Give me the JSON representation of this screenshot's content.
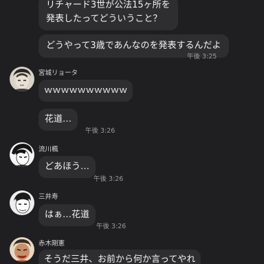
{
  "messages": [
    {
      "sender": "",
      "lines": [
        "リチャード3世が公法15ヶ所を",
        "発表したってどういうこと？"
      ],
      "time": ""
    },
    {
      "sender": "",
      "lines": [
        "どうやって3歳であんなのを発表するんだよ"
      ],
      "time": "午後 3:25"
    },
    {
      "sender": "宮城リョータ",
      "lines": [
        "ｗｗｗｗｗｗｗｗｗｗ"
      ],
      "time": ""
    },
    {
      "sender": "",
      "lines": [
        "花道…"
      ],
      "time": "午後 3:26"
    },
    {
      "sender": "流川楓",
      "lines": [
        "どあほう…"
      ],
      "time": "午後 3:26"
    },
    {
      "sender": "三井寿",
      "lines": [
        "はぁ…花道"
      ],
      "time": "午後 3:26"
    },
    {
      "sender": "赤木剛憲",
      "lines": [
        "そうだ三井、お前から何か言ってやれ"
      ],
      "time": ""
    }
  ],
  "avatars": [
    "miyagi-avatar",
    "rukawa-avatar",
    "mitsui-avatar",
    "akagi-avatar"
  ]
}
